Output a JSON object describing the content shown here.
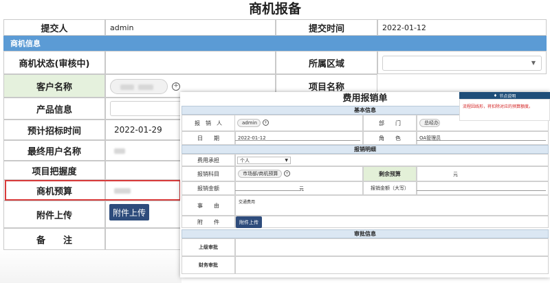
{
  "page_title": "商机报备",
  "back_form": {
    "submitter_label": "提交人",
    "submitter_value": "admin",
    "submit_time_label": "提交时间",
    "submit_time_value": "2022-01-12",
    "section_info": "商机信息",
    "status_label": "商机状态(审核中)",
    "region_label": "所属区域",
    "customer_label": "客户名称",
    "project_label": "项目名称",
    "product_label": "产品信息",
    "bid_time_label": "预计招标时间",
    "bid_time_value": "2022-01-29",
    "end_user_label": "最终用户名称",
    "certainty_label": "项目把握度",
    "budget_label": "商机预算",
    "attachment_label": "附件上传",
    "attachment_button": "附件上传",
    "remark_label": "备　　注"
  },
  "overlay": {
    "title": "费用报销单",
    "section_basic": "基本信息",
    "reporter_label": "报　销　人",
    "reporter_value": "admin",
    "dept_label": "部　　门",
    "dept_value": "总经办",
    "date_label": "日　　期",
    "date_value": "2022-01-12",
    "role_label": "角　　色",
    "role_value": "OA管理员",
    "section_detail": "报销明细",
    "bearer_label": "费用承担",
    "bearer_value": "个人",
    "subject_label": "报销科目",
    "subject_value": "市场部/商机预算",
    "remaining_label": "剩余预算",
    "remaining_unit": "元",
    "amount_label": "报销金额",
    "amount_unit": "元",
    "amount_upper_label": "报销金额（大写）",
    "reason_label": "事　　由",
    "reason_value": "交通费用",
    "attach_label": "附　　件",
    "attach_button": "附件上传",
    "section_approval": "审批信息",
    "superior_label": "上级审批",
    "finance_label": "财务审批"
  },
  "note": {
    "header": "节点说明",
    "body": "流程因线形，将扣除对应的预算额度。"
  }
}
